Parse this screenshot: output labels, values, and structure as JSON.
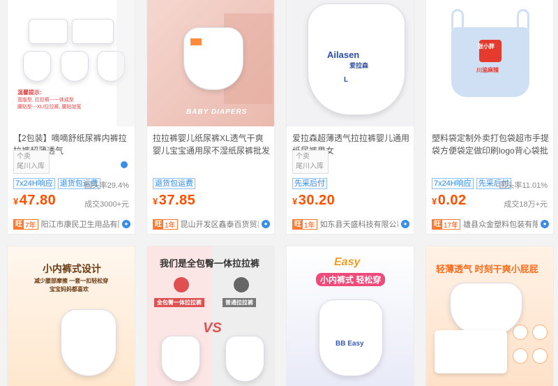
{
  "products": [
    {
      "title": "【2包装】嘀嘀舒纸尿裤内裤拉拉裤超薄透气",
      "shop_image_text": [
        "个卖",
        "尾川入库"
      ],
      "tags": [
        "7x24H响应",
        "退货包运费"
      ],
      "return_rate": "回头率29.4%",
      "price": "47.80",
      "sold": "成交3000+元",
      "years": "7年",
      "shop": "阳江市康民卫生用品有限公司",
      "image_text": [
        "温馨提示:",
        "宽版型, 拉拉裤---一体成型",
        "腰贴型---XL/拉拉裤, 腰贴加宽"
      ]
    },
    {
      "title": "拉拉裤婴儿纸尿裤XL透气干爽婴儿宝宝通用尿不湿纸尿裤批发",
      "tags": [
        "退货包运费"
      ],
      "price": "37.85",
      "years": "1年",
      "shop": "昆山开发区鑫泰百货贸易商行",
      "image_text": [
        "BABY DIAPERS"
      ]
    },
    {
      "title": "爱拉森超薄透气拉拉裤婴儿通用纸尿裤男女",
      "shop_image_text": [
        "个卖",
        "尾川入库"
      ],
      "tags": [
        "先采后付"
      ],
      "price": "30.20",
      "years": "1年",
      "shop": "如东县天盛科技有限公司",
      "image_text": [
        "Ailasen",
        "爱拉森",
        "L"
      ]
    },
    {
      "title": "塑料袋定制外卖打包袋超市手提袋方便袋定做印刷logo背心袋批发",
      "tags": [
        "7x24H响应",
        "先采后付"
      ],
      "return_rate": "回头率11.01%",
      "price": "0.02",
      "sold": "成交18万+元",
      "years": "17年",
      "shop": "雄县众金塑料包装有限公司",
      "image_text": [
        "张小胖",
        "川渝麻辣"
      ]
    },
    {
      "image_text": [
        "小内裤式设计",
        "减少腰部摩擦 一套一扣轻松穿",
        "宝宝妈妈都喜欢"
      ]
    },
    {
      "image_text": [
        "我们是全包臀一体拉拉裤",
        "全包臀一体拉拉裤",
        "普通拉拉裤",
        "VS"
      ]
    },
    {
      "image_text": [
        "Easy",
        "小内裤式 轻松穿",
        "BB Easy"
      ]
    },
    {
      "image_text": [
        "轻薄透气 时刻干爽小屁屁"
      ]
    }
  ],
  "currency": "¥",
  "badge_icon": "旺",
  "colors": {
    "price": "#ff5000",
    "tag_blue": "#3a8ee6",
    "badge_orange": "#ff7a2e"
  },
  "icons": [
    "wangwang-chat-icon",
    "shop-badge-icon"
  ]
}
